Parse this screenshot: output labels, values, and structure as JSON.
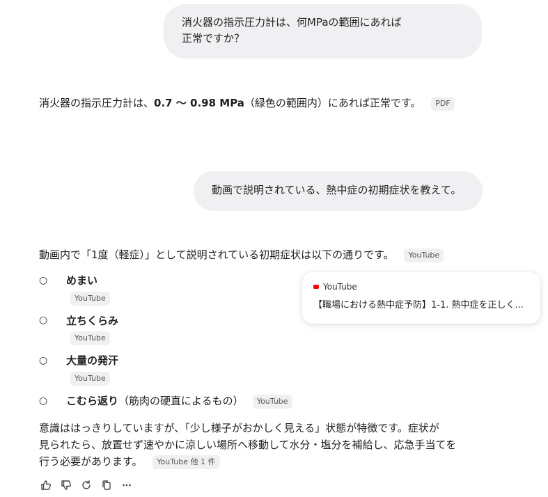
{
  "conversation": {
    "user_message_1": {
      "line1": "消火器の指示圧力計は、何MPaの範囲にあれば",
      "line2": "正常ですか？"
    },
    "answer_1": {
      "prefix": "消火器の指示圧力計は、",
      "bold": "0.7 〜 0.98 MPa",
      "suffix": "（緑色の範囲内）にあれば正常です。",
      "source_chip": "PDF"
    },
    "user_message_2": "動画で説明されている、熱中症の初期症状を教えて。",
    "answer_2": {
      "intro": "動画内で「1度（軽症）」として説明されている初期症状は以下の通りです。",
      "intro_chip": "YouTube",
      "bullets": [
        {
          "label": "めまい",
          "chip": "YouTube"
        },
        {
          "label": "立ちくらみ",
          "chip": "YouTube"
        },
        {
          "label": "大量の発汗",
          "chip": "YouTube"
        },
        {
          "label": "こむら返り",
          "note": "（筋肉の硬直によるもの）",
          "chip": "YouTube"
        }
      ],
      "paragraph": {
        "line1": "意識ははっきりしていますが、「少し様子がおかしく見える」状態が特徴です。症状が",
        "line2": "見られたら、放置せず速やかに涼しい場所へ移動して水分・塩分を補給し、応急手当てを",
        "line3": "行う必要があります。",
        "chip": "YouTube 他 1 件"
      }
    },
    "source_popup": {
      "source": "YouTube",
      "title": "【職場における熱中症予防】1-1. 熱中症を正しく..."
    }
  },
  "actions": [
    "thumbs-up-icon",
    "thumbs-down-icon",
    "regenerate-icon",
    "copy-icon",
    "more-icon"
  ],
  "colors": {
    "bubble": "#f0eff1",
    "chip": "#f0f0f0",
    "youtube_red": "#ff0000"
  }
}
